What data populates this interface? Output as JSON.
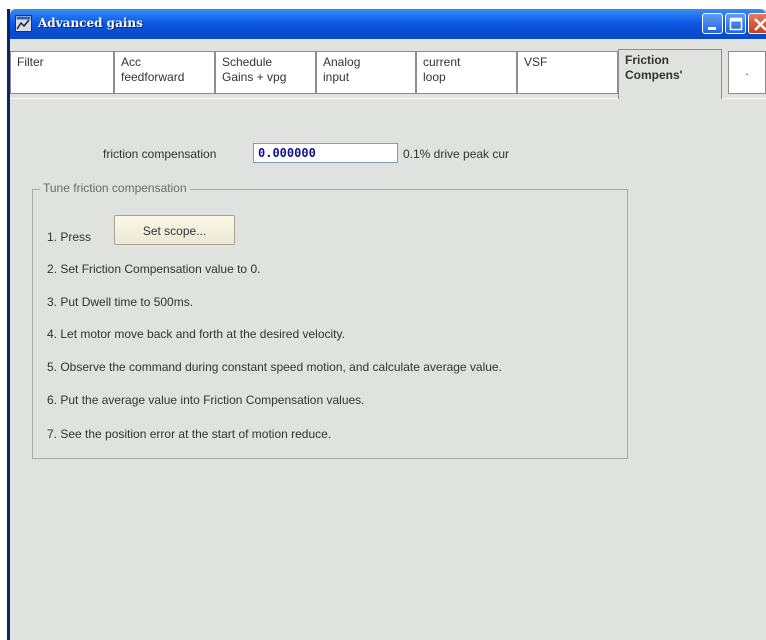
{
  "window": {
    "title": "Advanced gains",
    "icon": "app-window-icon"
  },
  "title_buttons": [
    "minimize-icon",
    "maximize-icon",
    "close-icon"
  ],
  "tabs": [
    {
      "label": "Filter"
    },
    {
      "label": "Acc\nfeedforward"
    },
    {
      "label": "Schedule\nGains + vpg"
    },
    {
      "label": "Analog\ninput"
    },
    {
      "label": "current\nloop"
    },
    {
      "label": "VSF"
    },
    {
      "label": "Friction\nCompens'",
      "active": true
    },
    {
      "label": "."
    }
  ],
  "friction": {
    "label": "friction compensation",
    "value": "0.000000",
    "unit": "0.1% drive peak cur"
  },
  "tune": {
    "title": "Tune friction compensation",
    "press_label": "1. Press",
    "scope_button": "Set scope...",
    "steps": [
      "2. Set Friction Compensation value to 0.",
      "3. Put Dwell time to 500ms.",
      "4. Let motor move back and forth at the desired velocity.",
      "5. Observe the command during constant speed motion, and calculate average value.",
      "6. Put the average value into Friction Compensation values.",
      "7. See the position error at the start of motion reduce."
    ]
  }
}
